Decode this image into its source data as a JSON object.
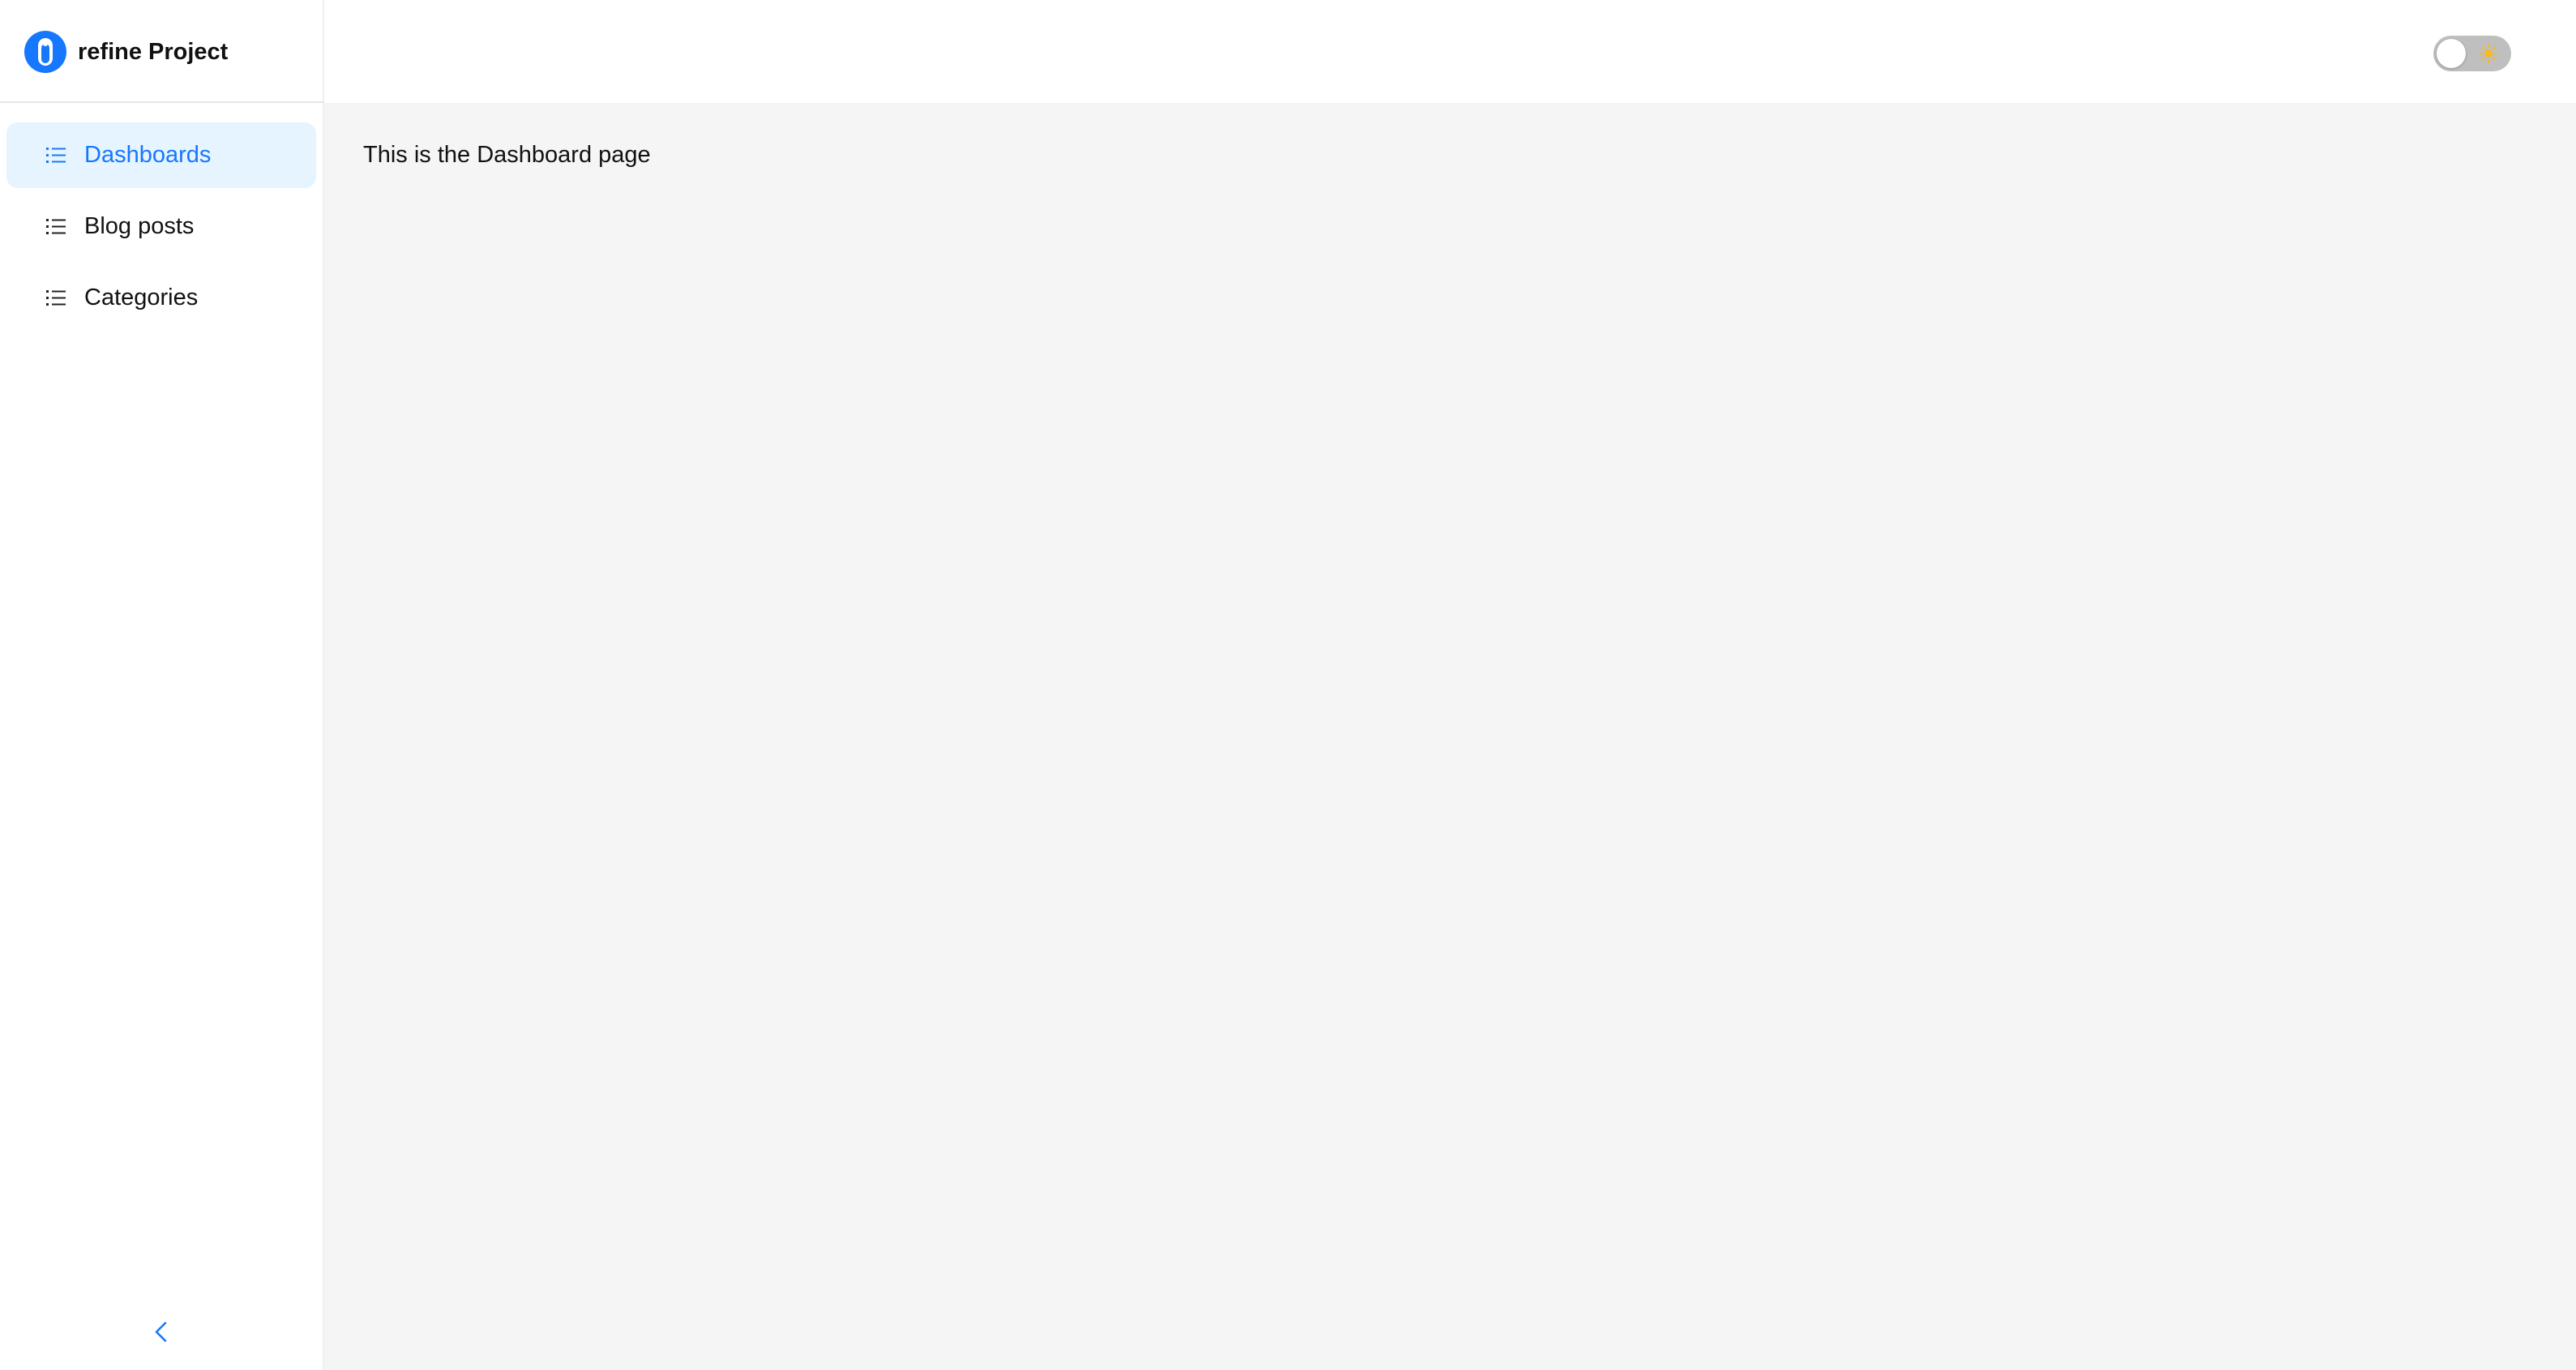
{
  "brand": {
    "title": "refine Project",
    "logo_icon": "refine-logo-icon",
    "color": "#1677ff"
  },
  "sidebar": {
    "items": [
      {
        "label": "Dashboards",
        "icon": "unordered-list-icon",
        "active": true
      },
      {
        "label": "Blog posts",
        "icon": "unordered-list-icon",
        "active": false
      },
      {
        "label": "Categories",
        "icon": "unordered-list-icon",
        "active": false
      }
    ],
    "collapse_icon": "chevron-left-icon"
  },
  "header": {
    "theme_toggle": {
      "state": "off",
      "icon": "sun-icon"
    }
  },
  "main": {
    "text": "This is the Dashboard page"
  },
  "colors": {
    "accent": "#1677ff",
    "active_bg": "#e6f4ff",
    "content_bg": "#f5f5f5",
    "toggle_bg": "#bfbfbf",
    "sun": "#f7b924"
  }
}
